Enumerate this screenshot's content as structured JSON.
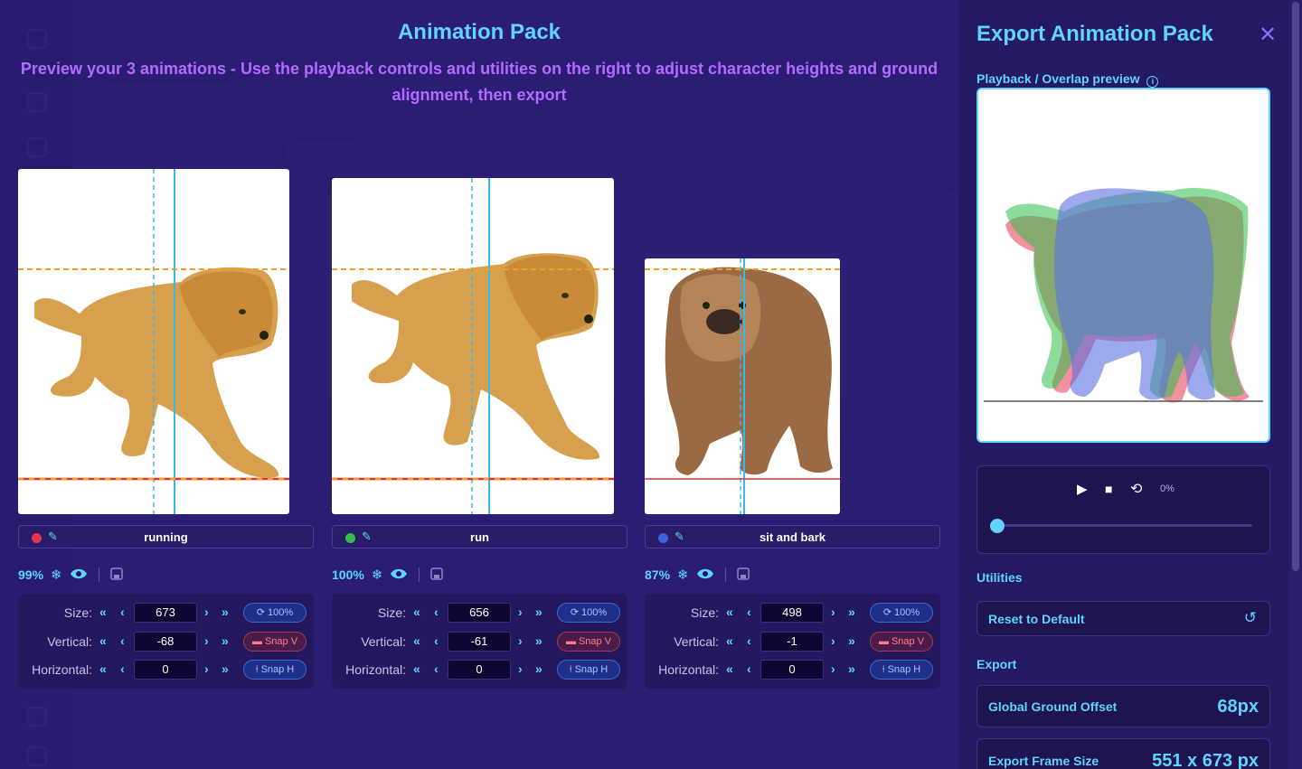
{
  "modal": {
    "title": "Animation Pack",
    "subtitle": "Preview your 3 animations - Use the playback controls and utilities on the right to adjust character heights and ground alignment, then export"
  },
  "animations": [
    {
      "name": "running",
      "dot_color": "#e8344e",
      "scale_percent": "99%",
      "size": "673",
      "vertical": "-68",
      "horizontal": "0",
      "reset_label": "100%",
      "snap_v_label": "Snap V",
      "snap_h_label": "Snap H",
      "size_label": "Size:",
      "vertical_label": "Vertical:",
      "horizontal_label": "Horizontal:"
    },
    {
      "name": "run",
      "dot_color": "#2fbf4a",
      "scale_percent": "100%",
      "size": "656",
      "vertical": "-61",
      "horizontal": "0",
      "reset_label": "100%",
      "snap_v_label": "Snap V",
      "snap_h_label": "Snap H",
      "size_label": "Size:",
      "vertical_label": "Vertical:",
      "horizontal_label": "Horizontal:"
    },
    {
      "name": "sit and bark",
      "dot_color": "#3b63e0",
      "scale_percent": "87%",
      "size": "498",
      "vertical": "-1",
      "horizontal": "0",
      "reset_label": "100%",
      "snap_v_label": "Snap V",
      "snap_h_label": "Snap H",
      "size_label": "Size:",
      "vertical_label": "Vertical:",
      "horizontal_label": "Horizontal:"
    }
  ],
  "export_panel": {
    "title": "Export Animation Pack",
    "preview_label": "Playback / Overlap preview",
    "playback": {
      "progress_text": "0%",
      "progress": 0
    },
    "utilities_label": "Utilities",
    "reset_default_label": "Reset to Default",
    "export_label": "Export",
    "global_ground_offset_label": "Global Ground Offset",
    "global_ground_offset_value": "68px",
    "export_frame_size_label": "Export Frame Size",
    "export_frame_size_value": "551 x 673 px"
  },
  "colors": {
    "accent": "#5fd4ff",
    "subtitle": "#b36bff",
    "guide_orange": "#f0a020",
    "guide_red": "#e0303a"
  }
}
